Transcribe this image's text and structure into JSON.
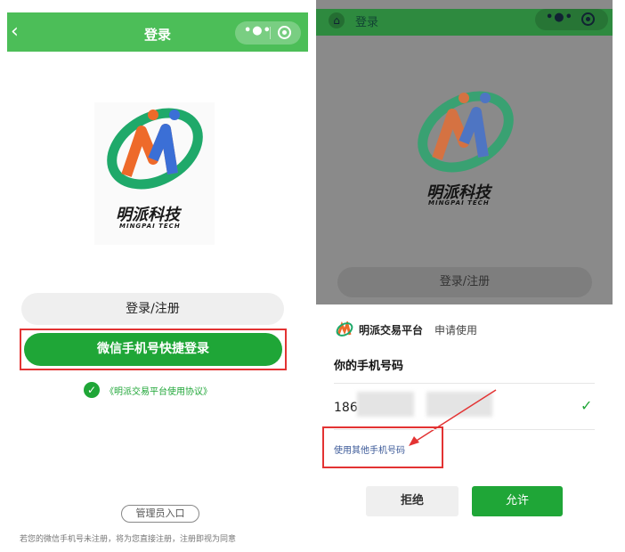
{
  "left_screen": {
    "header_title": "登录",
    "back_icon": "chevron-left-icon",
    "more_icon": "more-dots-icon",
    "close_icon": "target-circle-icon",
    "logo_name": "明派科技",
    "logo_subtitle": "MINGPAI TECH",
    "register_button": "登录/注册",
    "wechat_button": "微信手机号快捷登录",
    "agreement": "《明派交易平台使用协议》",
    "admin_button": "管理员入口",
    "footer_note": "若您的微信手机号未注册，将为您直接注册，注册即视为同意"
  },
  "right_screen": {
    "header_title": "登录",
    "home_icon": "home-icon",
    "logo_name": "明派科技",
    "logo_subtitle": "MINGPAI TECH",
    "register_button": "登录/注册",
    "app_name": "明派交易平台",
    "request_text": "申请使用",
    "section_title": "你的手机号码",
    "phone_prefix": "186",
    "use_other": "使用其他手机号码",
    "refuse_button": "拒绝",
    "allow_button": "允许"
  },
  "colors": {
    "header_green": "#4CBE58",
    "button_green": "#1fa637",
    "highlight_red": "#e33333"
  }
}
